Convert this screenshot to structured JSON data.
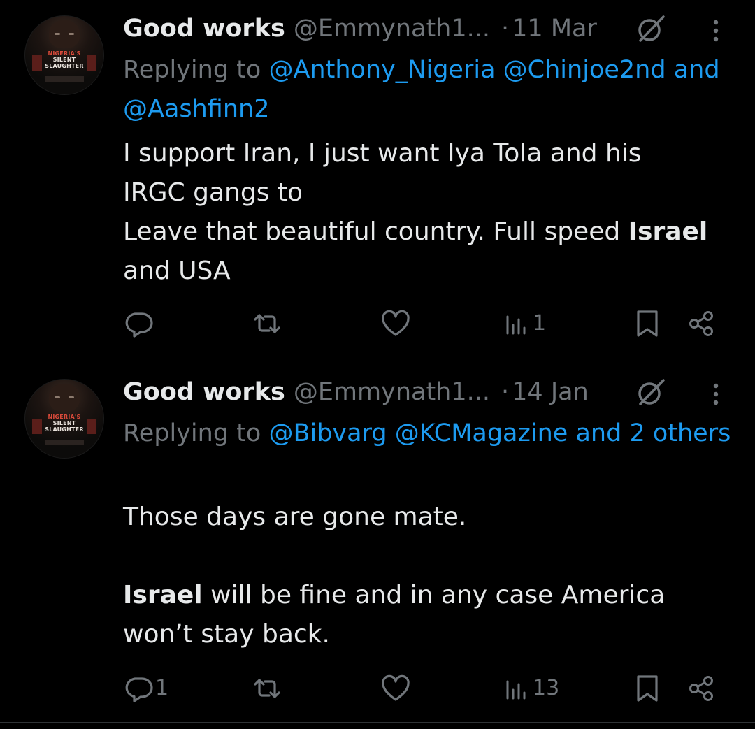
{
  "tweets": [
    {
      "author_name": "Good works",
      "handle": "@Emmynath1...",
      "separator": "·",
      "date": "11 Mar",
      "replying_prefix": "Replying to",
      "replying_mentions": [
        "@Anthony_Nigeria",
        "@Chinjoe2nd"
      ],
      "replying_and": "and",
      "replying_last": "@Aashfinn2",
      "body_segments": [
        {
          "text": "I support Iran, I just want Iya Tola and his\nIRGC gangs to\nLeave that beautiful country. Full speed ",
          "bold": false
        },
        {
          "text": "Israel",
          "bold": true
        },
        {
          "text": "\nand USA",
          "bold": false
        }
      ],
      "reply_count": "",
      "retweet_count": "",
      "like_count": "",
      "view_count": "1"
    },
    {
      "author_name": "Good works",
      "handle": "@Emmynath1...",
      "separator": "·",
      "date": "14 Jan",
      "replying_prefix": "Replying to",
      "replying_mentions": [
        "@Bibvarg",
        "@KCMagazine"
      ],
      "replying_and": "and 2",
      "replying_last": "others",
      "body_segments": [
        {
          "text": "Those days are gone mate.\n\n",
          "bold": false
        },
        {
          "text": "Israel",
          "bold": true
        },
        {
          "text": " will be fine and in any case America\nwon’t stay back.",
          "bold": false
        }
      ],
      "reply_count": "1",
      "retweet_count": "",
      "like_count": "",
      "view_count": "13"
    }
  ],
  "avatar_poster_text": [
    "NIGERIA'S",
    "SILENT",
    "SLAUGHTER"
  ],
  "colors": {
    "background": "#000000",
    "text_primary": "#e7e9ea",
    "text_secondary": "#71767b",
    "link": "#1d9bf0",
    "divider": "#2f3336"
  },
  "icons": [
    "grok-icon",
    "more-icon",
    "reply-icon",
    "retweet-icon",
    "like-icon",
    "views-icon",
    "bookmark-icon",
    "share-icon"
  ]
}
